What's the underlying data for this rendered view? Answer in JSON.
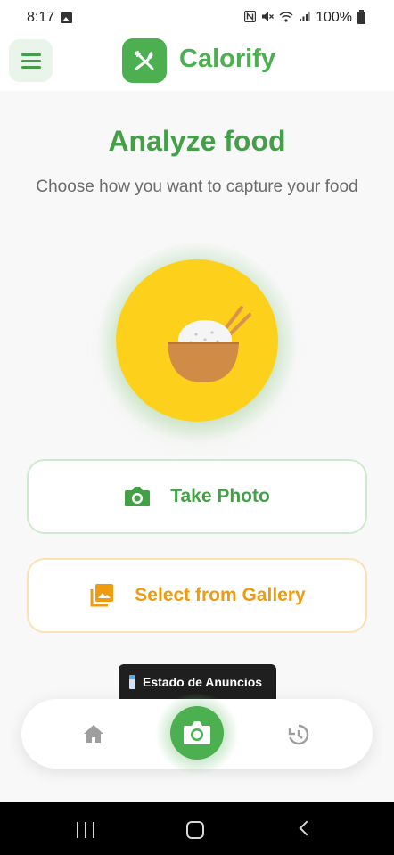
{
  "status_bar": {
    "time": "8:17",
    "battery": "100%",
    "icons": [
      "gallery-notification-icon",
      "nfc-icon",
      "mute-icon",
      "wifi-icon",
      "signal-icon",
      "battery-icon"
    ]
  },
  "header": {
    "app_name": "Calorify",
    "menu_icon": "hamburger-menu-icon",
    "logo_icon": "fork-spoon-icon"
  },
  "main": {
    "title": "Analyze food",
    "subtitle": "Choose how you want to capture your food",
    "hero_icon": "rice-bowl-icon",
    "take_photo_label": "Take Photo",
    "gallery_label": "Select from Gallery"
  },
  "toast": {
    "text": "Estado de Anuncios"
  },
  "bottom_nav": {
    "items": [
      "home-icon",
      "camera-icon",
      "history-icon"
    ]
  },
  "colors": {
    "primary": "#4caf50",
    "title_green": "#43a047",
    "accent_orange": "#ef9b0f",
    "hero_yellow": "#fdd11b"
  }
}
